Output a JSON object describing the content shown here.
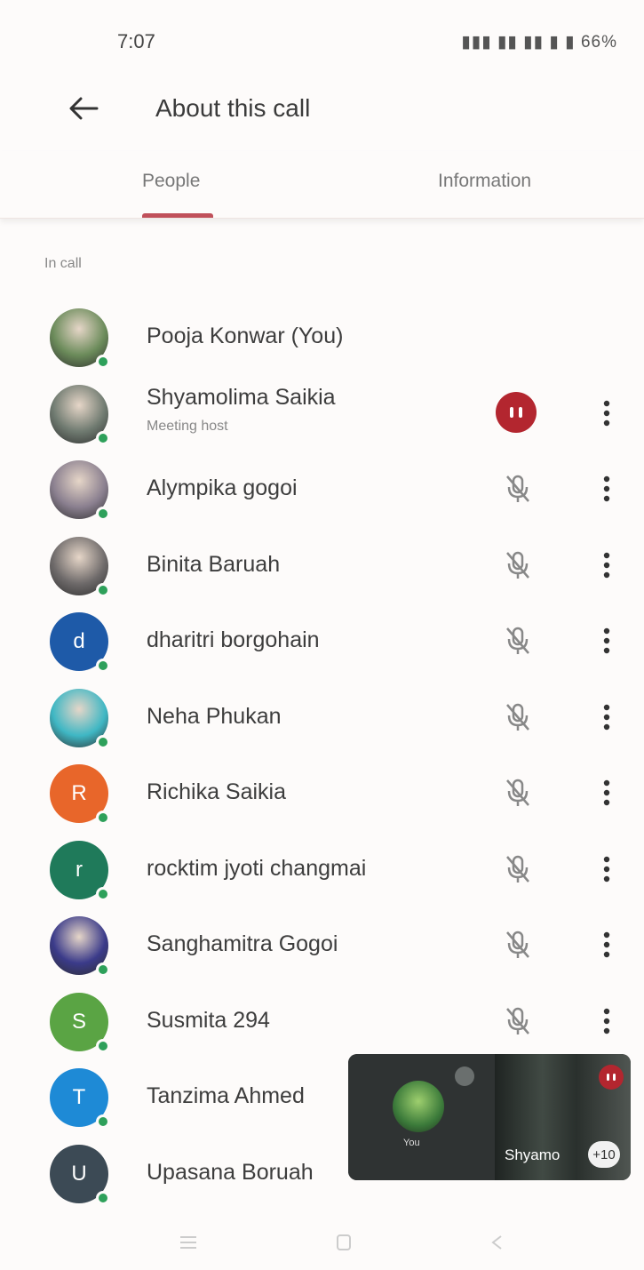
{
  "status_bar": {
    "time": "7:07",
    "right_text": "66%"
  },
  "app_bar": {
    "title": "About this call"
  },
  "tabs": [
    {
      "label": "People",
      "active": true
    },
    {
      "label": "Information",
      "active": false
    }
  ],
  "section": {
    "label": "In call"
  },
  "participants": [
    {
      "name": "Pooja Konwar (You)",
      "subtitle": "",
      "avatar_type": "photo",
      "avatar_color": "#6b8b5a",
      "mic": "none"
    },
    {
      "name": "Shyamolima Saikia",
      "subtitle": "Meeting host",
      "avatar_type": "photo",
      "avatar_color": "#6f7a70",
      "mic": "speaking"
    },
    {
      "name": "Alympika gogoi",
      "subtitle": "",
      "avatar_type": "photo",
      "avatar_color": "#8a7f8f",
      "mic": "muted"
    },
    {
      "name": "Binita Baruah",
      "subtitle": "",
      "avatar_type": "photo",
      "avatar_color": "#6e6a6a",
      "mic": "muted"
    },
    {
      "name": "dharitri borgohain",
      "subtitle": "",
      "avatar_type": "letter",
      "initial": "d",
      "avatar_color": "#1e5aa8",
      "mic": "muted"
    },
    {
      "name": "Neha Phukan",
      "subtitle": "",
      "avatar_type": "photo",
      "avatar_color": "#3fb7c4",
      "mic": "muted"
    },
    {
      "name": "Richika Saikia",
      "subtitle": "",
      "avatar_type": "letter",
      "initial": "R",
      "avatar_color": "#e8662a",
      "mic": "muted"
    },
    {
      "name": "rocktim jyoti changmai",
      "subtitle": "",
      "avatar_type": "letter",
      "initial": "r",
      "avatar_color": "#1f7a5a",
      "mic": "muted"
    },
    {
      "name": "Sanghamitra Gogoi",
      "subtitle": "",
      "avatar_type": "photo",
      "avatar_color": "#3b3b8a",
      "mic": "muted"
    },
    {
      "name": "Susmita 294",
      "subtitle": "",
      "avatar_type": "letter",
      "initial": "S",
      "avatar_color": "#5aa444",
      "mic": "muted"
    },
    {
      "name": "Tanzima Ahmed",
      "subtitle": "",
      "avatar_type": "letter",
      "initial": "T",
      "avatar_color": "#1e8ad6",
      "mic": "none"
    },
    {
      "name": "Upasana Boruah",
      "subtitle": "",
      "avatar_type": "letter",
      "initial": "U",
      "avatar_color": "#3c4a55",
      "mic": "none"
    }
  ],
  "pip": {
    "self_label": "You",
    "speaker_name": "Shyamo",
    "extra_count": "+10"
  },
  "colors": {
    "accent": "#c0505a",
    "speaking": "#b3262f",
    "online": "#2ea05a"
  }
}
